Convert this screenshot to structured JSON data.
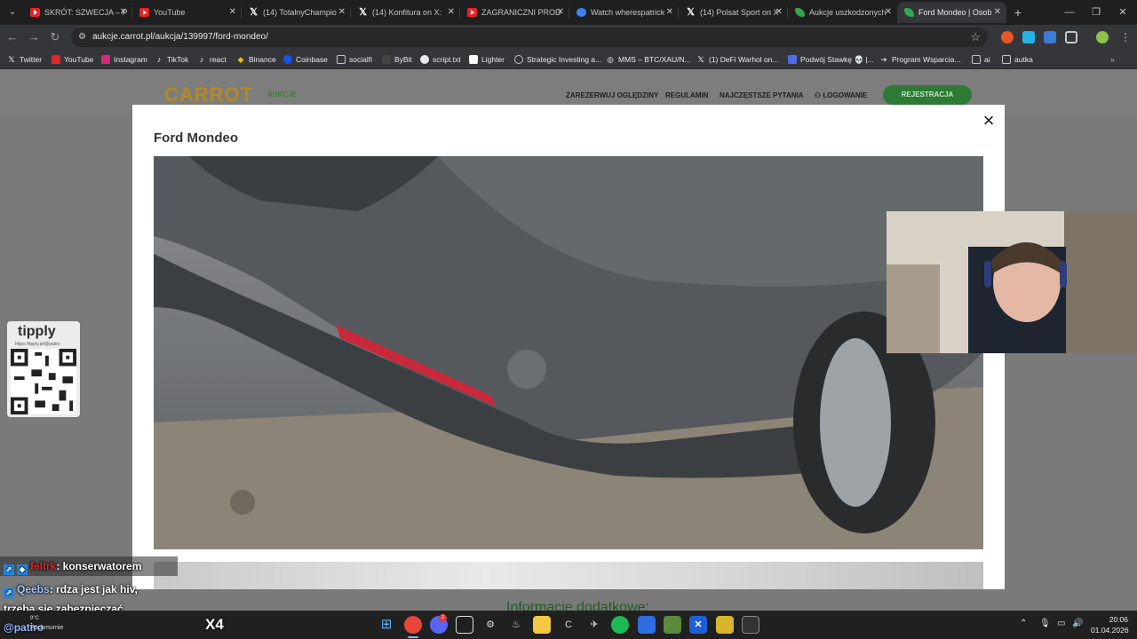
{
  "browser": {
    "tabs": [
      {
        "label": "SKRÓT: SZWECJA – P",
        "icon": "youtube"
      },
      {
        "label": "YouTube",
        "icon": "youtube"
      },
      {
        "label": "(14) TotalnyChampio",
        "icon": "x"
      },
      {
        "label": "(14) Konfitura on X: ",
        "icon": "x"
      },
      {
        "label": "ZAGRANICZNI PROD",
        "icon": "youtube"
      },
      {
        "label": "Watch wherespatrick",
        "icon": "watch"
      },
      {
        "label": "(14) Polsat Sport on X",
        "icon": "x"
      },
      {
        "label": "Aukcje uszkodzonych",
        "icon": "carrot"
      },
      {
        "label": "Ford Mondeo | Osob",
        "icon": "carrot",
        "active": true
      }
    ],
    "url": "aukcje.carrot.pl/aukcja/139997/ford-mondeo/",
    "bookmarks": [
      "Twitter",
      "YouTube",
      "Instagram",
      "TikTok",
      "react",
      "Binance",
      "Coinbase",
      "socialfi",
      "ByBit",
      "script.txt",
      "Lighter",
      "Strategic Investing a...",
      "MMS – BTC/XAU/N...",
      "(1) DeFi Warhol on...",
      "Podwój Stawkę 💀 |...",
      "Program Wsparcia...",
      "ai",
      "autka"
    ]
  },
  "site": {
    "logo": "CARROT",
    "logo_sub": "AUKCJE",
    "nav": [
      "ZAREZERWUJ OGLĘDZINY",
      "REGULAMIN",
      "NAJCZĘSTSZE PYTANIA",
      "LOGOWANIE"
    ],
    "register": "REJESTRACJA",
    "info_heading": "Informacje dodatkowe:"
  },
  "modal": {
    "title": "Ford Mondeo",
    "close": "×"
  },
  "overlay": {
    "tipply_logo": "tipply",
    "tipply_url": "https://tipply.pl/@patiro",
    "chat": [
      {
        "user": "feltrk",
        "message": ": konserwatorem"
      },
      {
        "user": "Qeebs",
        "message": ": rdza jest jak hiv,"
      },
      {
        "user": "",
        "message": "trzeba się zabezpieczać"
      }
    ],
    "handle": "@patiro",
    "weather_temp": "9°C",
    "weather_desc": "Pochmurnie",
    "x4": "X4"
  },
  "taskbar": {
    "time": "20:06",
    "date": "01.04.2026",
    "discord_badge": "2"
  },
  "colors": {
    "accent_green": "#2c7a34",
    "logo_gold": "#b58a24",
    "tail_reflector": "#c8283a"
  }
}
